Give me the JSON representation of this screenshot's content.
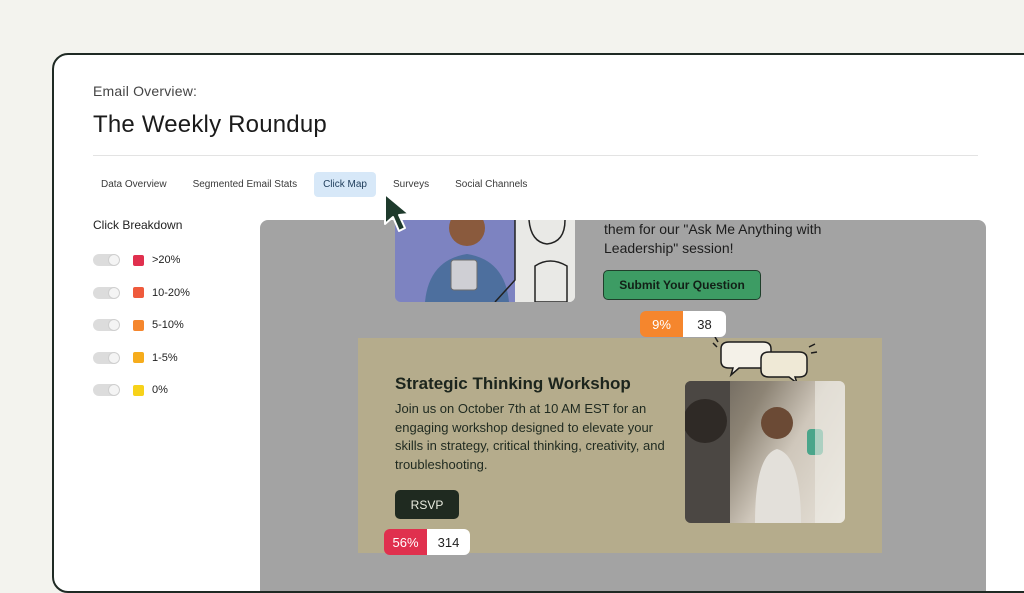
{
  "header": {
    "eyebrow": "Email Overview:",
    "title": "The Weekly Roundup"
  },
  "tabs": [
    {
      "label": "Data Overview",
      "active": false
    },
    {
      "label": "Segmented Email Stats",
      "active": false
    },
    {
      "label": "Click Map",
      "active": true
    },
    {
      "label": "Surveys",
      "active": false
    },
    {
      "label": "Social Channels",
      "active": false
    }
  ],
  "sidebar": {
    "title": "Click Breakdown",
    "legend": [
      {
        "label": ">20%",
        "color": "#e0304e"
      },
      {
        "label": "10-20%",
        "color": "#ef5a3c"
      },
      {
        "label": "5-10%",
        "color": "#f5862d"
      },
      {
        "label": "1-5%",
        "color": "#f6ac1c"
      },
      {
        "label": "0%",
        "color": "#f7d21a"
      }
    ]
  },
  "preview": {
    "top_text": "them for our \"Ask Me Anything with Leadership\" session!",
    "submit_label": "Submit Your Question",
    "submit_stat": {
      "percent": "9%",
      "count": "38",
      "color": "#f5862d"
    },
    "workshop": {
      "title": "Strategic Thinking Workshop",
      "description": "Join us on October 7th at 10 AM EST for an engaging workshop designed to elevate your skills in strategy, critical thinking, creativity, and troubleshooting.",
      "rsvp_label": "RSVP",
      "rsvp_stat": {
        "percent": "56%",
        "count": "314",
        "color": "#e0304e"
      }
    }
  },
  "icons": {
    "cursor": "mouse-pointer-icon",
    "toggle": "toggle-switch-icon",
    "speech_bubbles": "speech-bubbles-icon"
  }
}
